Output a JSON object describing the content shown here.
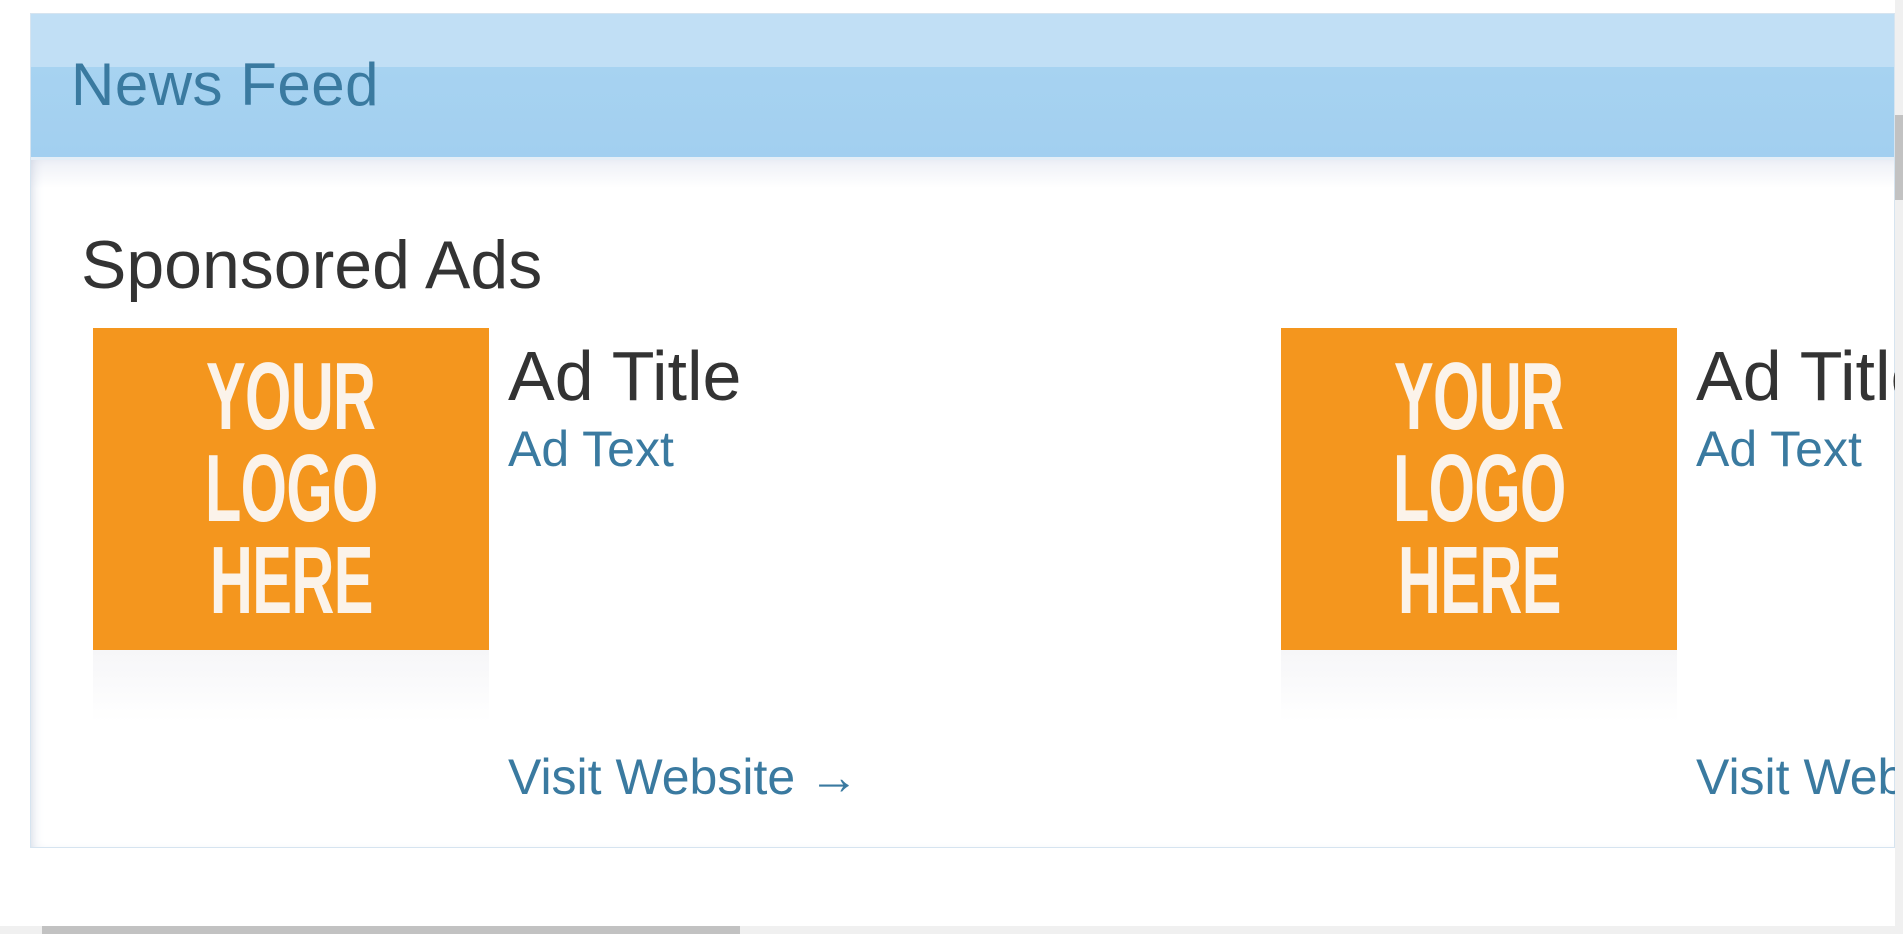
{
  "panel": {
    "title": "News Feed"
  },
  "sponsored": {
    "heading": "Sponsored Ads",
    "ads": [
      {
        "logo_lines": [
          "YOUR",
          "LOGO",
          "HERE"
        ],
        "title": "Ad Title",
        "text": "Ad Text",
        "link": "Visit Website →"
      },
      {
        "logo_lines": [
          "YOUR",
          "LOGO",
          "HERE"
        ],
        "title": "Ad Title",
        "text": "Ad Text",
        "link": "Visit Website →"
      }
    ]
  },
  "colors": {
    "header_blue": "#a7d3f1",
    "link_blue": "#3a7aa0",
    "logo_orange": "#f4961e"
  }
}
